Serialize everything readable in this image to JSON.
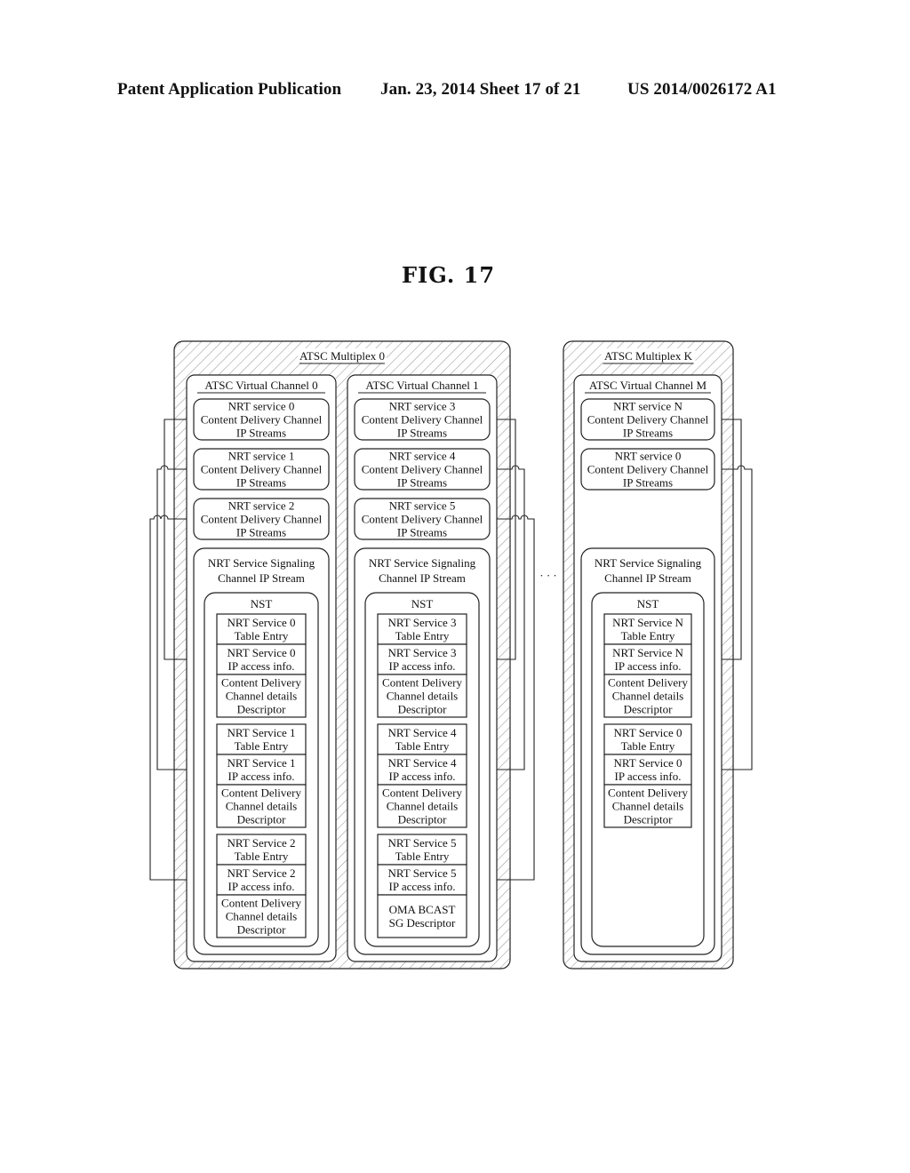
{
  "header": {
    "publication": "Patent Application Publication",
    "date_sheet": "Jan. 23, 2014  Sheet 17 of 21",
    "patent_number": "US 2014/0026172 A1"
  },
  "figure": {
    "title": "FIG. 17",
    "ellipsis": "· · ·",
    "colors": {
      "line": "#222222",
      "hatch": "#555555",
      "background": "#ffffff"
    },
    "multiplexes": [
      {
        "label": "ATSC Multiplex 0",
        "channels": [
          {
            "label": "ATSC Virtual Channel 0",
            "cdc_boxes": [
              [
                "NRT service 0",
                "Content Delivery Channel",
                "IP Streams"
              ],
              [
                "NRT service 1",
                "Content Delivery Channel",
                "IP Streams"
              ],
              [
                "NRT service 2",
                "Content Delivery Channel",
                "IP Streams"
              ]
            ],
            "signaling": [
              "NRT Service Signaling",
              "Channel IP Stream"
            ],
            "nst_label": "NST",
            "entries": [
              {
                "table_entry": [
                  "NRT Service 0",
                  "Table Entry"
                ],
                "ip_access": [
                  "NRT Service 0",
                  "IP access info."
                ],
                "descriptor": [
                  "Content Delivery",
                  "Channel details",
                  "Descriptor"
                ]
              },
              {
                "table_entry": [
                  "NRT Service 1",
                  "Table Entry"
                ],
                "ip_access": [
                  "NRT Service 1",
                  "IP access info."
                ],
                "descriptor": [
                  "Content Delivery",
                  "Channel details",
                  "Descriptor"
                ]
              },
              {
                "table_entry": [
                  "NRT Service 2",
                  "Table Entry"
                ],
                "ip_access": [
                  "NRT Service 2",
                  "IP access info."
                ],
                "descriptor": [
                  "Content Delivery",
                  "Channel details",
                  "Descriptor"
                ]
              }
            ],
            "link_side": "left"
          },
          {
            "label": "ATSC Virtual Channel 1",
            "cdc_boxes": [
              [
                "NRT service 3",
                "Content Delivery Channel",
                "IP Streams"
              ],
              [
                "NRT service 4",
                "Content Delivery Channel",
                "IP Streams"
              ],
              [
                "NRT service 5",
                "Content Delivery Channel",
                "IP Streams"
              ]
            ],
            "signaling": [
              "NRT Service Signaling",
              "Channel IP Stream"
            ],
            "nst_label": "NST",
            "entries": [
              {
                "table_entry": [
                  "NRT Service 3",
                  "Table Entry"
                ],
                "ip_access": [
                  "NRT Service 3",
                  "IP access info."
                ],
                "descriptor": [
                  "Content Delivery",
                  "Channel details",
                  "Descriptor"
                ]
              },
              {
                "table_entry": [
                  "NRT Service 4",
                  "Table Entry"
                ],
                "ip_access": [
                  "NRT Service 4",
                  "IP access info."
                ],
                "descriptor": [
                  "Content Delivery",
                  "Channel details",
                  "Descriptor"
                ]
              },
              {
                "table_entry": [
                  "NRT Service 5",
                  "Table Entry"
                ],
                "ip_access": [
                  "NRT Service 5",
                  "IP access info."
                ],
                "descriptor": [
                  "OMA BCAST",
                  "SG Descriptor"
                ]
              }
            ],
            "link_side": "right"
          }
        ]
      },
      {
        "label": "ATSC Multiplex K",
        "channels": [
          {
            "label": "ATSC Virtual Channel M",
            "cdc_boxes": [
              [
                "NRT service N",
                "Content Delivery Channel",
                "IP Streams"
              ],
              [
                "NRT service 0",
                "Content Delivery Channel",
                "IP Streams"
              ]
            ],
            "signaling": [
              "NRT Service Signaling",
              "Channel IP Stream"
            ],
            "nst_label": "NST",
            "entries": [
              {
                "table_entry": [
                  "NRT Service N",
                  "Table Entry"
                ],
                "ip_access": [
                  "NRT Service N",
                  "IP access info."
                ],
                "descriptor": [
                  "Content Delivery",
                  "Channel details",
                  "Descriptor"
                ]
              },
              {
                "table_entry": [
                  "NRT Service 0",
                  "Table Entry"
                ],
                "ip_access": [
                  "NRT Service 0",
                  "IP access info."
                ],
                "descriptor": [
                  "Content Delivery",
                  "Channel details",
                  "Descriptor"
                ]
              }
            ],
            "link_side": "right"
          }
        ]
      }
    ]
  }
}
